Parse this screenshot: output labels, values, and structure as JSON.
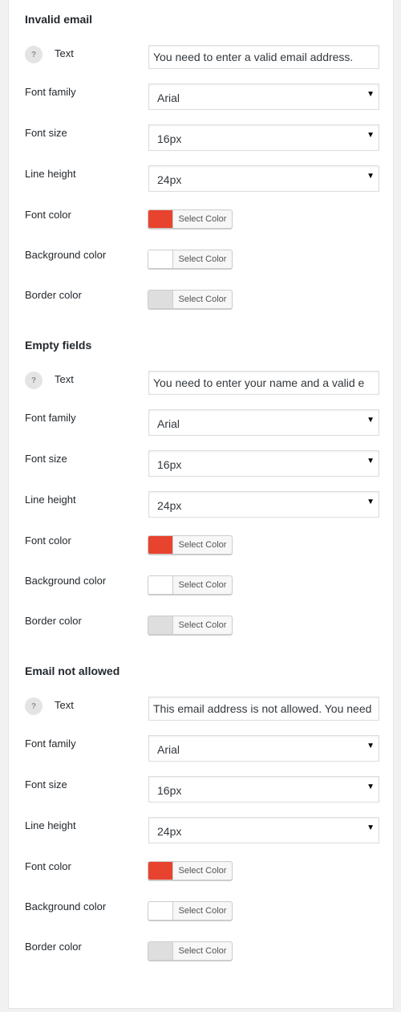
{
  "labels": {
    "text": "Text",
    "font_family": "Font family",
    "font_size": "Font size",
    "line_height": "Line height",
    "font_color": "Font color",
    "background_color": "Background color",
    "border_color": "Border color",
    "select_color": "Select Color",
    "help": "?"
  },
  "sections": [
    {
      "title": "Invalid email",
      "text_value": "You need to enter a valid email address.",
      "font_family": "Arial",
      "font_size": "16px",
      "line_height": "24px",
      "font_color": "#e8432f",
      "background_color": "#ffffff",
      "border_color": "#dedede"
    },
    {
      "title": "Empty fields",
      "text_value": "You need to enter your name and a valid e",
      "font_family": "Arial",
      "font_size": "16px",
      "line_height": "24px",
      "font_color": "#e8432f",
      "background_color": "#ffffff",
      "border_color": "#dedede"
    },
    {
      "title": "Email not allowed",
      "text_value": "This email address is not allowed. You need",
      "font_family": "Arial",
      "font_size": "16px",
      "line_height": "24px",
      "font_color": "#e8432f",
      "background_color": "#ffffff",
      "border_color": "#dedede"
    }
  ]
}
